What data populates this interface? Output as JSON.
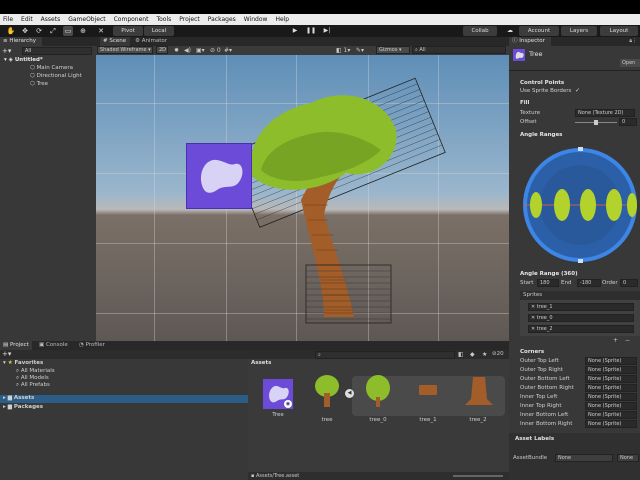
{
  "menu": [
    "File",
    "Edit",
    "Assets",
    "GameObject",
    "Component",
    "Tools",
    "Project",
    "Packages",
    "Window",
    "Help"
  ],
  "toolbar": {
    "pivot": "Pivot",
    "local": "Local",
    "collab": "Collab",
    "account": "Account",
    "layers": "Layers",
    "layout": "Layout"
  },
  "hierarchy": {
    "tab": "Hierarchy",
    "search_placeholder": "All",
    "scene_name": "Untitled*",
    "items": [
      "Main Camera",
      "Directional Light",
      "Tree"
    ]
  },
  "scene": {
    "tabs": [
      "Scene",
      "Animator"
    ],
    "shading": "Shaded Wireframe",
    "mode": "2D",
    "gizmos": "Gizmos",
    "search_placeholder": "All",
    "camera_count": "1"
  },
  "project": {
    "tabs": [
      "Project",
      "Console",
      "Profiler"
    ],
    "favorites_label": "Favorites",
    "favorites": [
      "All Materials",
      "All Models",
      "All Prefabs"
    ],
    "folders": [
      "Assets",
      "Packages"
    ],
    "assets_header": "Assets",
    "icon_count": "20",
    "assets": [
      "Tree",
      "tree",
      "tree_0",
      "tree_1",
      "tree_2"
    ],
    "path": "Assets/Tree.asset"
  },
  "inspector": {
    "tab": "Inspector",
    "object_name": "Tree",
    "open_button": "Open",
    "control_points": "Control Points",
    "use_sprite_borders": "Use Sprite Borders",
    "fill": "Fill",
    "texture_label": "Texture",
    "texture_value": "None (Texture 2D)",
    "offset_label": "Offset",
    "offset_value": "0",
    "angle_ranges": "Angle Ranges",
    "angle_range_title": "Angle Range (360)",
    "start_label": "Start",
    "start_value": "180",
    "end_label": "End",
    "end_value": "-180",
    "order_label": "Order",
    "order_value": "0",
    "sprites_label": "Sprites",
    "sprites": [
      "tree_1",
      "tree_0",
      "tree_2"
    ],
    "corners_label": "Corners",
    "corners": [
      "Outer Top Left",
      "Outer Top Right",
      "Outer Bottom Left",
      "Outer Bottom Right",
      "Inner Top Left",
      "Inner Top Right",
      "Inner Bottom Left",
      "Inner Bottom Right"
    ],
    "corner_value": "None (Sprite)",
    "asset_labels": "Asset Labels",
    "asset_bundle_label": "AssetBundle",
    "asset_bundle_value": "None",
    "asset_bundle_variant": "None"
  },
  "colors": {
    "accent_blue": "#3d7bd9",
    "logo_purple": "#6b4bd8",
    "tree_green": "#8fbe2a",
    "trunk_brown": "#a8612a"
  }
}
